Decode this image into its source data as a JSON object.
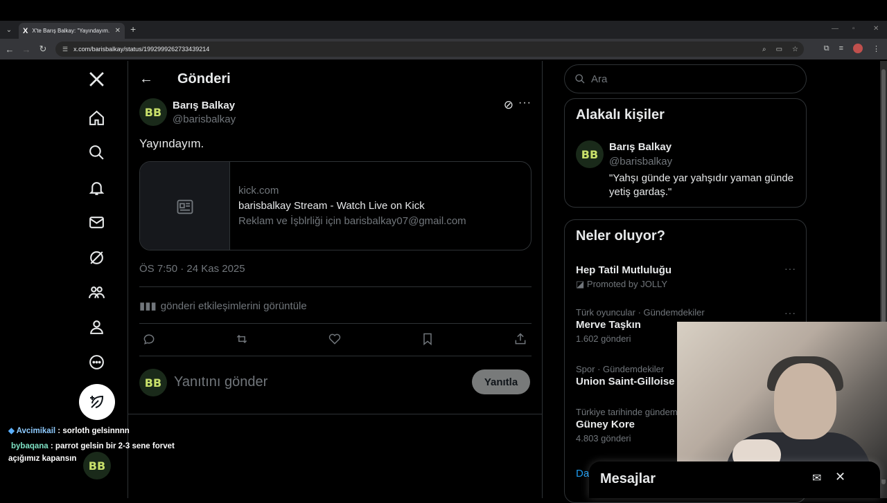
{
  "browser": {
    "tab_title": "X'te Barış Balkay: \"Yayındayım. h",
    "tab_favicon": "X",
    "url": "x.com/barisbalkay/status/1992999262733439214"
  },
  "page": {
    "title": "Gönderi"
  },
  "tweet": {
    "author_name": "Barış Balkay",
    "author_handle": "@barisbalkay",
    "avatar_text": "BB",
    "text": "Yayındayım.",
    "card": {
      "domain": "kick.com",
      "title": "barisbalkay Stream - Watch Live on Kick",
      "description": "Reklam ve İşblrliği için barisbalkay07@gmail.com"
    },
    "timestamp": "ÖS 7:50 · 24 Kas 2025",
    "engagement_link": "gönderi etkileşimlerini görüntüle",
    "reply_placeholder": "Yanıtını gönder",
    "reply_button": "Yanıtla"
  },
  "sidebar": {
    "search_placeholder": "Ara",
    "relevant": {
      "title": "Alakalı kişiler",
      "name": "Barış Balkay",
      "handle": "@barisbalkay",
      "bio": "\"Yahşı günde yar yahşıdır yaman günde yetiş gardaş.\""
    },
    "trends": {
      "title": "Neler oluyor?",
      "items": [
        {
          "meta": "",
          "name": "Hep Tatil Mutluluğu",
          "count": "Promoted by JOLLY"
        },
        {
          "meta": "Türk oyuncular · Gündemdekiler",
          "name": "Merve Taşkın",
          "count": "1.602 gönderi"
        },
        {
          "meta": "Spor · Gündemdekiler",
          "name": "Union Saint-Gilloise",
          "count": ""
        },
        {
          "meta": "Türkiye tarihinde gündem",
          "name": "Güney Kore",
          "count": "4.803 gönderi"
        }
      ],
      "show_more": "Da"
    }
  },
  "messages": {
    "title": "Mesajlar"
  },
  "chat": [
    {
      "user": "Avcimikail",
      "text": ": sorloth gelsinnnn"
    },
    {
      "user": "bybaqana",
      "text": ": parrot gelsin bir 2-3 sene forvet açığımız kapansın"
    }
  ]
}
